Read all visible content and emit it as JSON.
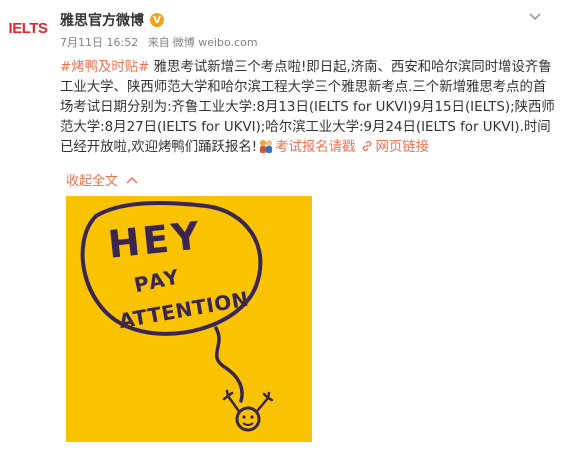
{
  "account": {
    "avatar_text": "IELTS",
    "name": "雅思官方微博",
    "verified_mark": "V",
    "date": "7月11日 16:52",
    "source_prefix": "来自",
    "source": "微博 weibo.com"
  },
  "post": {
    "hashtag": "#烤鸭及时贴#",
    "body_1": " 雅思考试新增三个考点啦!即日起,济南、西安和哈尔滨同时增设齐鲁工业大学、陕西师范大学和哈尔滨工程大学三个雅思新考点.三个新增雅思考点的首场考试日期分别为:齐鲁工业大学:8月13日(IELTS for UKVI)9月15日(IELTS);陕西师范大学:8月27日(IELTS for UKVI);哈尔滨工业大学:9月24日(IELTS for UKVI).时间已经开放啦,欢迎烤鸭们踊跃报名!",
    "emoji_icon": "people-emoji",
    "location_link": "考试报名请戳",
    "web_link": "网页链接",
    "collapse_label": "收起全文"
  },
  "image": {
    "line1": "HEY",
    "line2": "PAY",
    "line3": "ATTENTION",
    "background_color": "#f9c300",
    "ink_color": "#3a2450"
  },
  "colors": {
    "link": "#eb7350",
    "meta": "#808080",
    "brand_red": "#e0262b"
  }
}
